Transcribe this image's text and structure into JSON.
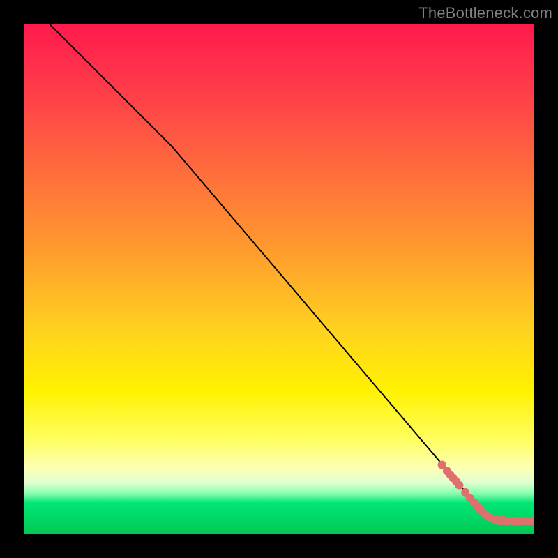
{
  "watermark": "TheBottleneck.com",
  "chart_data": {
    "type": "line",
    "title": "",
    "xlabel": "",
    "ylabel": "",
    "xlim": [
      0,
      100
    ],
    "ylim": [
      0,
      100
    ],
    "series": [
      {
        "name": "curve",
        "x": [
          5,
          29,
          88.5,
          93,
          100
        ],
        "y": [
          100,
          76,
          6,
          2.5,
          2.5
        ],
        "stroke": "#000000",
        "stroke_width": 2
      }
    ],
    "markers": {
      "name": "points",
      "color": "#e07070",
      "radius": 6,
      "points": [
        {
          "x": 82.0,
          "y": 13.5
        },
        {
          "x": 83.0,
          "y": 12.3
        },
        {
          "x": 83.6,
          "y": 11.6
        },
        {
          "x": 84.2,
          "y": 10.9
        },
        {
          "x": 84.8,
          "y": 10.2
        },
        {
          "x": 85.4,
          "y": 9.5
        },
        {
          "x": 86.6,
          "y": 8.1
        },
        {
          "x": 87.5,
          "y": 7.0
        },
        {
          "x": 88.3,
          "y": 6.1
        },
        {
          "x": 88.9,
          "y": 5.4
        },
        {
          "x": 89.5,
          "y": 4.7
        },
        {
          "x": 90.3,
          "y": 3.9
        },
        {
          "x": 91.0,
          "y": 3.4
        },
        {
          "x": 91.7,
          "y": 3.0
        },
        {
          "x": 92.5,
          "y": 2.7
        },
        {
          "x": 93.3,
          "y": 2.6
        },
        {
          "x": 94.1,
          "y": 2.6
        },
        {
          "x": 94.9,
          "y": 2.5
        },
        {
          "x": 96.0,
          "y": 2.5
        },
        {
          "x": 96.8,
          "y": 2.5
        },
        {
          "x": 97.6,
          "y": 2.5
        },
        {
          "x": 98.7,
          "y": 2.5
        },
        {
          "x": 99.8,
          "y": 2.5
        }
      ]
    }
  }
}
